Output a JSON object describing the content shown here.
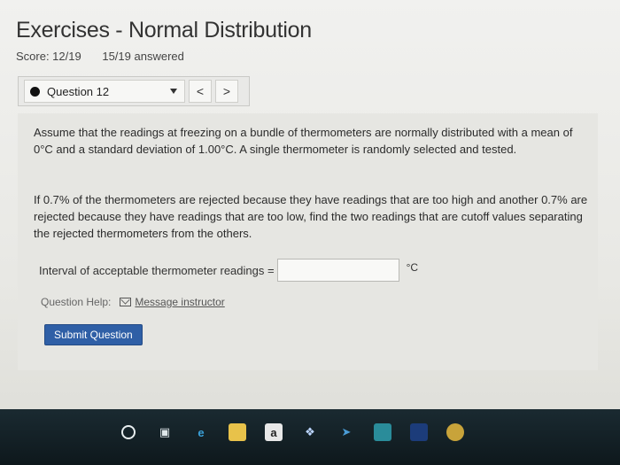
{
  "header": {
    "title": "Exercises - Normal Distribution",
    "score": "Score: 12/19",
    "answered": "15/19 answered"
  },
  "question_nav": {
    "selected": "Question 12",
    "prev_label": "<",
    "next_label": ">"
  },
  "question": {
    "paragraph1": "Assume that the readings at freezing on a bundle of thermometers are normally distributed with a mean of 0°C and a standard deviation of 1.00°C. A single thermometer is randomly selected and tested.",
    "paragraph2": "If 0.7% of the thermometers are rejected because they have readings that are too high and another 0.7% are rejected because they have readings that are too low, find the two readings that are cutoff values separating the rejected thermometers from the others.",
    "answer_label": "Interval of acceptable thermometer readings =",
    "answer_value": "",
    "unit": "°C"
  },
  "help": {
    "label": "Question Help:",
    "link": "Message instructor"
  },
  "submit_label": "Submit Question",
  "taskbar": {
    "icons": [
      "cortana-icon",
      "task-view-icon",
      "edge-icon",
      "file-explorer-icon",
      "amazon-icon",
      "dropbox-icon",
      "app-icon",
      "app-icon-2",
      "app-icon-3",
      "chrome-icon"
    ]
  }
}
